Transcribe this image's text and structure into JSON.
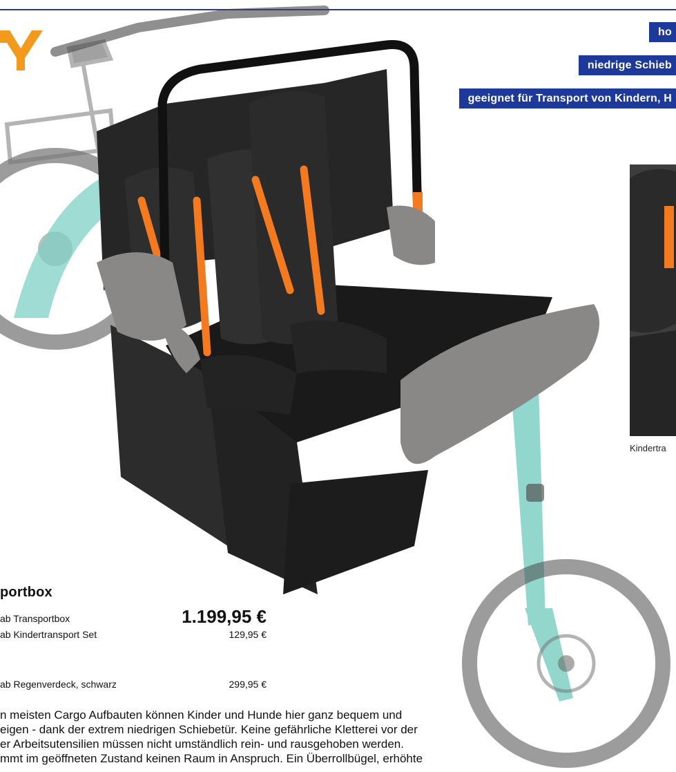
{
  "tags": {
    "line1": "ho",
    "line2": "niedrige Schieb",
    "line3": "geeignet für Transport von Kindern, H"
  },
  "logo": {
    "name": "brand-logo",
    "color": "#f39a1e"
  },
  "detail": {
    "caption": "Kindertra"
  },
  "product": {
    "heading": "portbox",
    "rows": [
      {
        "label": "ab Transportbox",
        "price": "1.199,95 €"
      },
      {
        "label": "ab Kindertransport Set",
        "price": "129,95 €"
      },
      {
        "label": "ab Regenverdeck, schwarz",
        "price": "299,95 €"
      }
    ]
  },
  "body": {
    "lines": [
      "n meisten Cargo Aufbauten können Kinder und Hunde hier ganz bequem und",
      "eigen - dank der extrem niedrigen Schiebetür. Keine gefährliche Kletterei vor der",
      "er Arbeitsutensilien müssen nicht umständlich rein- und rausgehoben werden.",
      "mmt im geöffneten Zustand keinen Raum in Anspruch. Ein Überrollbügel, erhöhte"
    ]
  },
  "colors": {
    "accent": "#1d3a9a",
    "strap": "#f47a1f",
    "frame": "#7fd0c4",
    "foam": "#8a8886"
  }
}
